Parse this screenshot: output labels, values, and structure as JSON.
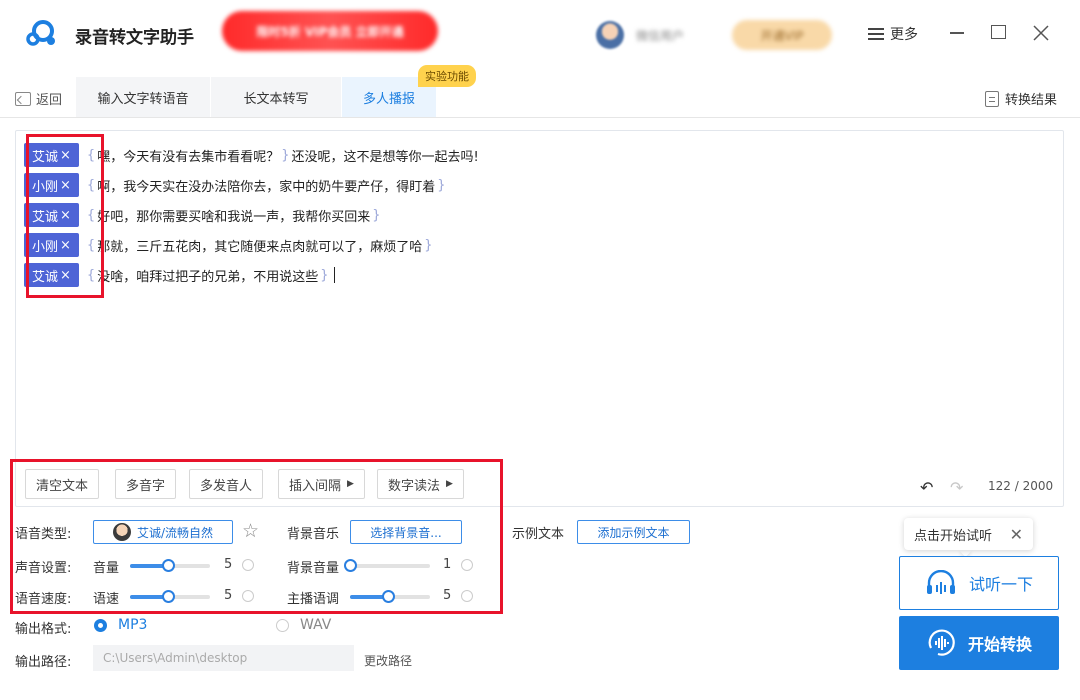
{
  "app": {
    "title": "录音转文字助手",
    "promo_text": "限时5折 VIP会员 立即开通",
    "user_name": "微信用户",
    "vip_label": "开通VIP",
    "more_label": "更多"
  },
  "nav": {
    "back_label": "返回",
    "result_label": "转换结果",
    "tabs": [
      {
        "label": "输入文字转语音"
      },
      {
        "label": "长文本转写"
      },
      {
        "label": "多人播报"
      }
    ],
    "experimental_badge": "实验功能"
  },
  "editor": {
    "lines": [
      {
        "speaker": "艾诚",
        "text": "嘿，今天有没有去集市看看呢？",
        "after": "还没呢，这不是想等你一起去吗!"
      },
      {
        "speaker": "小刚",
        "text": "啊，我今天实在没办法陪你去，家中的奶牛要产仔，得盯着",
        "after": ""
      },
      {
        "speaker": "艾诚",
        "text": "好吧，那你需要买啥和我说一声，我帮你买回来",
        "after": ""
      },
      {
        "speaker": "小刚",
        "text": "那就，三斤五花肉，其它随便来点肉就可以了，麻烦了哈",
        "after": ""
      },
      {
        "speaker": "艾诚",
        "text": "没啥，咱拜过把子的兄弟，不用说这些",
        "after": ""
      }
    ],
    "close_glyph": "×",
    "tools": {
      "clear": "清空文本",
      "polyphone": "多音字",
      "multi_speaker": "多发音人",
      "insert_pause": "插入间隔",
      "number_reading": "数字读法"
    },
    "counter": "122 / 2000"
  },
  "settings": {
    "voice_type_label": "语音类型:",
    "voice_value": "艾诚/流畅自然",
    "bgm_label": "背景音乐",
    "bgm_button": "选择背景音...",
    "sample_label": "示例文本",
    "sample_button": "添加示例文本",
    "sound_label": "声音设置:",
    "volume_label": "音量",
    "volume_value": "5",
    "bg_volume_label": "背景音量",
    "bg_volume_value": "1",
    "speed_section_label": "语音速度:",
    "speed_label": "语速",
    "speed_value": "5",
    "pitch_label": "主播语调",
    "pitch_value": "5",
    "format_label": "输出格式:",
    "format_options": [
      "MP3",
      "WAV"
    ],
    "format_selected": "MP3",
    "path_label": "输出路径:",
    "path_value": "C:\\Users\\Admin\\desktop",
    "change_path": "更改路径"
  },
  "slider_levels": {
    "volume": 0.47,
    "bg_volume": 0.0,
    "speed": 0.47,
    "pitch": 0.47
  },
  "actions": {
    "tooltip": "点击开始试听",
    "listen": "试听一下",
    "convert": "开始转换"
  },
  "colors": {
    "accent": "#1d7fe0",
    "speaker_tag": "#4e64d6",
    "highlight_box": "#e8132b",
    "badge": "#ffd24d"
  }
}
